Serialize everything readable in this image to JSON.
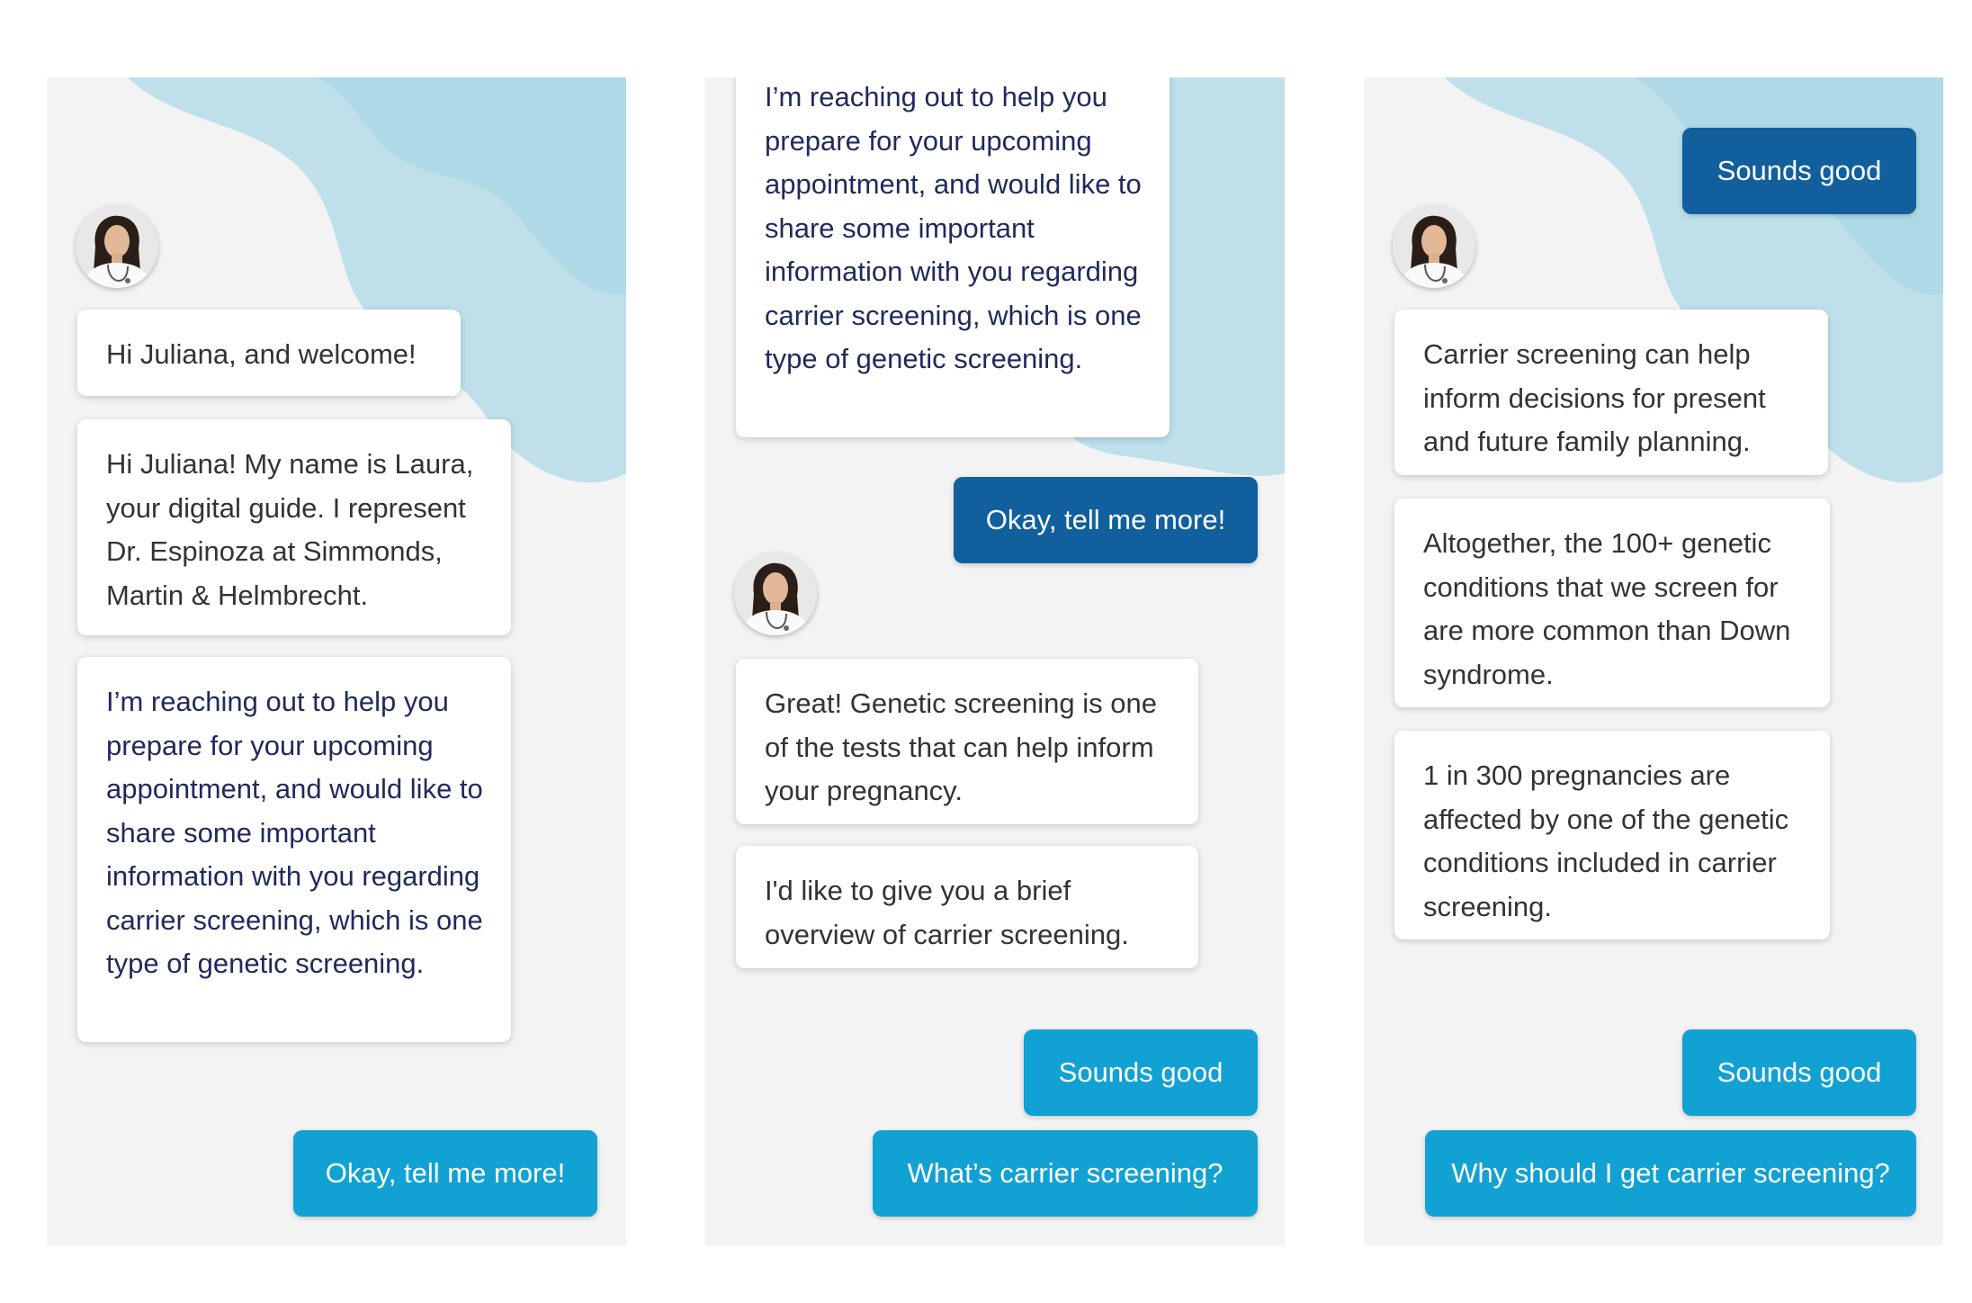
{
  "colors": {
    "panel_bg": "#f3f3f3",
    "blob": "#b9dde9",
    "button_light": "#12a1d3",
    "button_dark": "#11609d",
    "navy_text": "#1f2a5c",
    "text": "#333333"
  },
  "icons": {
    "guide_avatar": "female-doctor-avatar"
  },
  "screen1": {
    "welcome": "Hi Juliana, and welcome!",
    "intro": "Hi Juliana! My name is Laura, your digital guide. I represent Dr. Espinoza at Simmonds, Martin & Helmbrecht.",
    "reaching": "I’m reaching out to help you prepare for your upcoming appointment, and would like to share some important information with you regarding carrier screening, which is one type of genetic screening.",
    "reply_button": "Okay, tell me more!"
  },
  "screen2": {
    "reaching": "I’m reaching out to help you prepare for your upcoming appointment, and would like to share some important information with you regarding carrier screening, which is one type of genetic screening.",
    "user_reply": "Okay, tell me more!",
    "great": "Great! Genetic screening is one of the tests that can help inform your pregnancy.",
    "overview": "I'd like to give you a brief overview of carrier screening.",
    "option1": "Sounds good",
    "option2": "What’s carrier screening?"
  },
  "screen3": {
    "user_reply": "Sounds good",
    "inform": "Carrier screening can help inform decisions for present and future family planning.",
    "altogether": "Altogether, the 100+ genetic conditions that we screen for are more common than Down syndrome.",
    "stat": "1 in 300 pregnancies are affected by one of the genetic conditions included in carrier screening.",
    "option1": "Sounds good",
    "option2": "Why should I get carrier screening?"
  }
}
